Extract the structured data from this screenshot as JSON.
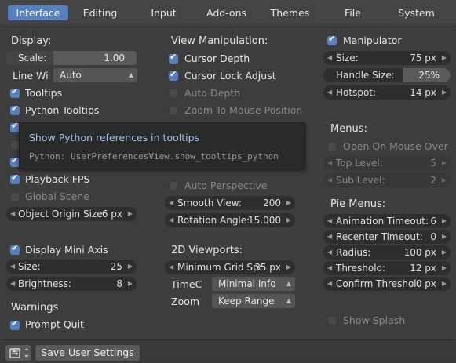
{
  "tabs": [
    "Interface",
    "Editing",
    "Input",
    "Add-ons",
    "Themes",
    "File",
    "System"
  ],
  "display": {
    "heading": "Display:",
    "scale_label": "Scale:",
    "scale_value": "1.00",
    "line_width_label": "Line Wi",
    "line_width_value": "Auto",
    "tooltips": "Tooltips",
    "python_tooltips": "Python Tooltips",
    "playback_fps": "Playback FPS",
    "global_scene": "Global Scene",
    "object_origin_label": "Object Origin Size:",
    "object_origin_value": "6 px",
    "display_mini_axis": "Display Mini Axis",
    "size_label": "Size:",
    "size_value": "25",
    "brightness_label": "Brightness:",
    "brightness_value": "8"
  },
  "warnings": {
    "heading": "Warnings",
    "prompt_quit": "Prompt Quit"
  },
  "view_manipulation": {
    "heading": "View Manipulation:",
    "cursor_depth": "Cursor Depth",
    "cursor_lock_adjust": "Cursor Lock Adjust",
    "auto_depth": "Auto Depth",
    "zoom_to_mouse": "Zoom To Mouse Position",
    "auto_perspective": "Auto Perspective",
    "smooth_view_label": "Smooth View:",
    "smooth_view_value": "200",
    "rotation_angle_label": "Rotation Angle:",
    "rotation_angle_value": "15.000"
  },
  "viewports_2d": {
    "heading": "2D Viewports:",
    "min_grid_label": "Minimum Grid Sp:",
    "min_grid_value": "35 px",
    "timecode_label": "TimeC",
    "timecode_value": "Minimal Info",
    "zoom_label": "Zoom",
    "zoom_value": "Keep Range"
  },
  "manipulator": {
    "label": "Manipulator",
    "size_label": "Size:",
    "size_value": "75 px",
    "handle_size_label": "Handle Size:",
    "handle_size_value": "25%",
    "handle_size_fraction": 0.25,
    "hotspot_label": "Hotspot:",
    "hotspot_value": "14 px"
  },
  "menus": {
    "heading": "Menus:",
    "open_on_mouse_over": "Open On Mouse Over",
    "top_level_label": "Top Level:",
    "top_level_value": "5",
    "sub_level_label": "Sub Level:",
    "sub_level_value": "2"
  },
  "pie_menus": {
    "heading": "Pie Menus:",
    "animation_timeout_label": "Animation Timeout:",
    "animation_timeout_value": "6",
    "recenter_timeout_label": "Recenter Timeout:",
    "recenter_timeout_value": "0",
    "radius_label": "Radius:",
    "radius_value": "100 px",
    "threshold_label": "Threshold:",
    "threshold_value": "12 px",
    "confirm_threshold_label": "Confirm Threshol:",
    "confirm_threshold_value": "0 px"
  },
  "show_splash": "Show Splash",
  "tooltip": {
    "title": "Show Python references in tooltips",
    "python": "Python: UserPreferencesView.show_tooltips_python"
  },
  "footer": {
    "save_label": "Save User Settings"
  },
  "colors": {
    "accent": "#5680c2",
    "background": "#3d3d3d",
    "field": "#2e2e2e",
    "tooltip_title": "#9fc3ee"
  }
}
